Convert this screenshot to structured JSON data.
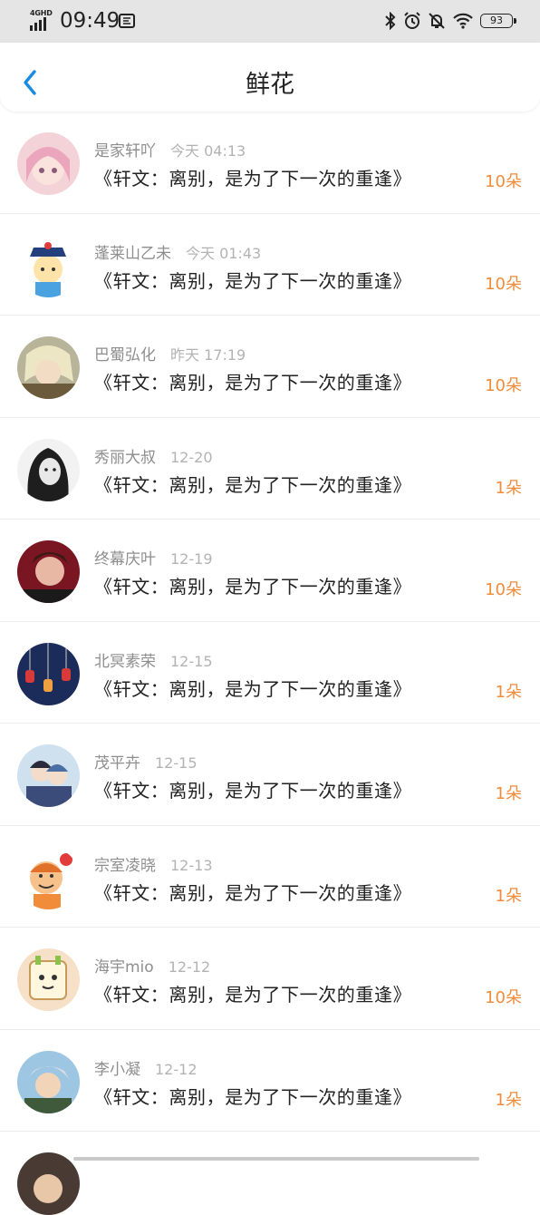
{
  "status": {
    "network": "4GHD",
    "time": "09:49",
    "battery": "93"
  },
  "nav": {
    "title": "鲜花"
  },
  "colors": {
    "accent": "#1a8ce0",
    "count": "#f08c3a",
    "name": "#8e8e8e",
    "time": "#b3b3b3"
  },
  "items": [
    {
      "name": "是家轩吖",
      "time": "今天 04:13",
      "message": "《轩文：离别，是为了下一次的重逢》",
      "count": "10朵",
      "avatar": "anime-girl-pink"
    },
    {
      "name": "蓬莱山乙未",
      "time": "今天 01:43",
      "message": "《轩文：离别，是为了下一次的重逢》",
      "count": "10朵",
      "avatar": "cartoon-official"
    },
    {
      "name": "巴蜀弘化",
      "time": "昨天 17:19",
      "message": "《轩文：离别，是为了下一次的重逢》",
      "count": "10朵",
      "avatar": "anime-blonde"
    },
    {
      "name": "秀丽大叔",
      "time": "12-20",
      "message": "《轩文：离别，是为了下一次的重逢》",
      "count": "1朵",
      "avatar": "bw-portrait"
    },
    {
      "name": "终幕庆叶",
      "time": "12-19",
      "message": "《轩文：离别，是为了下一次的重逢》",
      "count": "10朵",
      "avatar": "dark-red-portrait"
    },
    {
      "name": "北冥素荣",
      "time": "12-15",
      "message": "《轩文：离别，是为了下一次的重逢》",
      "count": "1朵",
      "avatar": "lanterns-night"
    },
    {
      "name": "茂平卉",
      "time": "12-15",
      "message": "《轩文：离别，是为了下一次的重逢》",
      "count": "1朵",
      "avatar": "anime-couple"
    },
    {
      "name": "宗室凌晓",
      "time": "12-13",
      "message": "《轩文：离别，是为了下一次的重逢》",
      "count": "1朵",
      "avatar": "cartoon-boy-orange"
    },
    {
      "name": "海宇mio",
      "time": "12-12",
      "message": "《轩文：离别，是为了下一次的重逢》",
      "count": "10朵",
      "avatar": "cartoon-square"
    },
    {
      "name": "李小凝",
      "time": "12-12",
      "message": "《轩文：离别，是为了下一次的重逢》",
      "count": "1朵",
      "avatar": "anime-silver-hair"
    }
  ]
}
